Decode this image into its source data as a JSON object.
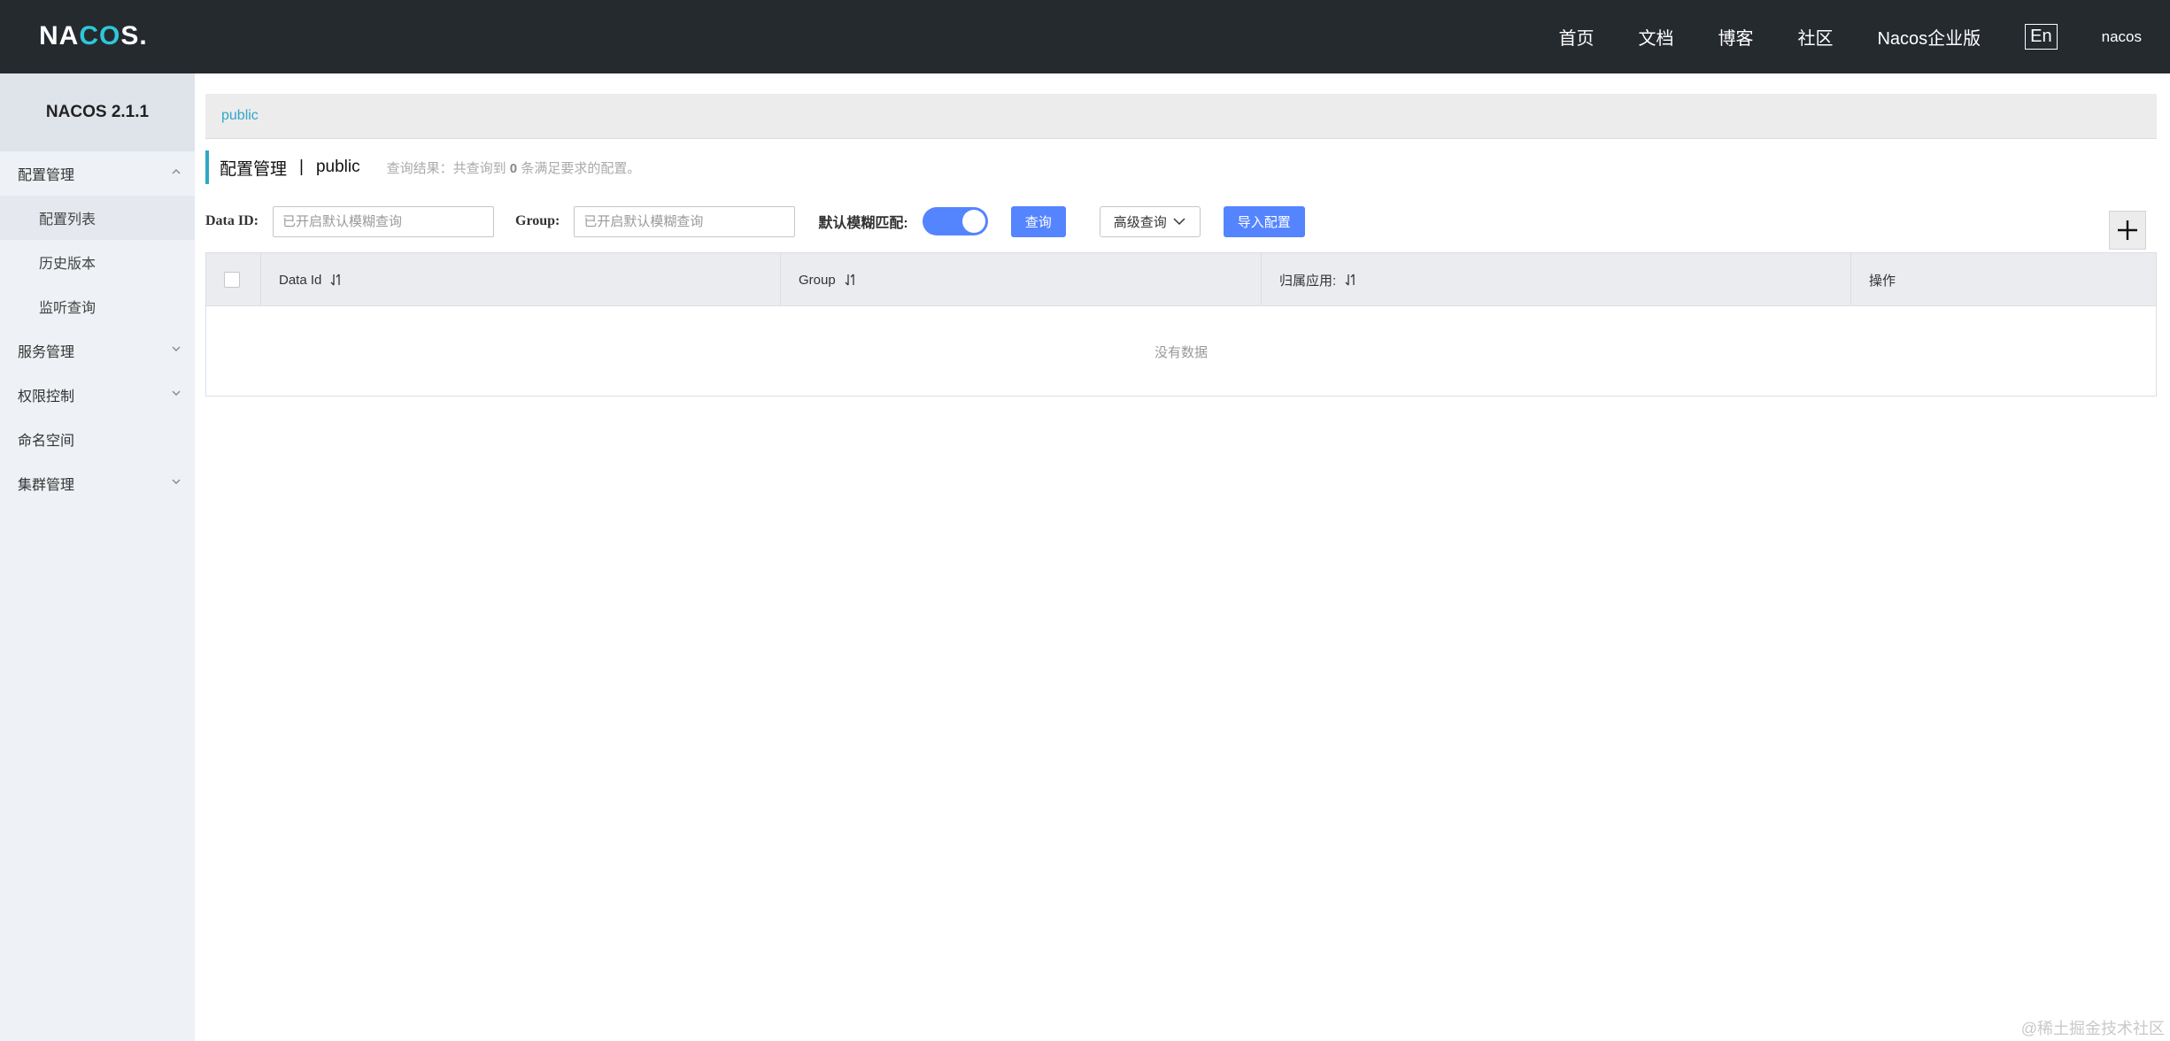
{
  "header": {
    "logo": "NACOS.",
    "nav": [
      "首页",
      "文档",
      "博客",
      "社区",
      "Nacos企业版"
    ],
    "lang": "En",
    "user": "nacos"
  },
  "sidebar": {
    "title": "NACOS 2.1.1",
    "groups": [
      {
        "label": "配置管理",
        "expanded": true,
        "subs": [
          "配置列表",
          "历史版本",
          "监听查询"
        ],
        "active_sub": "配置列表"
      },
      {
        "label": "服务管理",
        "expanded": false
      },
      {
        "label": "权限控制",
        "expanded": false
      },
      {
        "label": "命名空间"
      },
      {
        "label": "集群管理",
        "expanded": false
      }
    ]
  },
  "breadcrumb": {
    "namespace": "public"
  },
  "page": {
    "title": "配置管理",
    "separator": "|",
    "namespace": "public",
    "query_prefix": "查询结果：共查询到",
    "query_count": "0",
    "query_suffix": "条满足要求的配置。"
  },
  "filters": {
    "data_id_label": "Data ID:",
    "data_id_placeholder": "已开启默认模糊查询",
    "group_label": "Group:",
    "group_placeholder": "已开启默认模糊查询",
    "fuzzy_label": "默认模糊匹配:",
    "fuzzy_on": true,
    "search_btn": "查询",
    "advanced_btn": "高级查询",
    "import_btn": "导入配置"
  },
  "table": {
    "columns": [
      "Data Id",
      "Group",
      "归属应用:",
      "操作"
    ],
    "empty_text": "没有数据"
  },
  "watermark": "@稀土掘金技术社区",
  "colors": {
    "header_bg": "#252a2f",
    "accent": "#2fa7c7",
    "primary": "#5584ff",
    "logo_o": "#2ec7d9"
  }
}
